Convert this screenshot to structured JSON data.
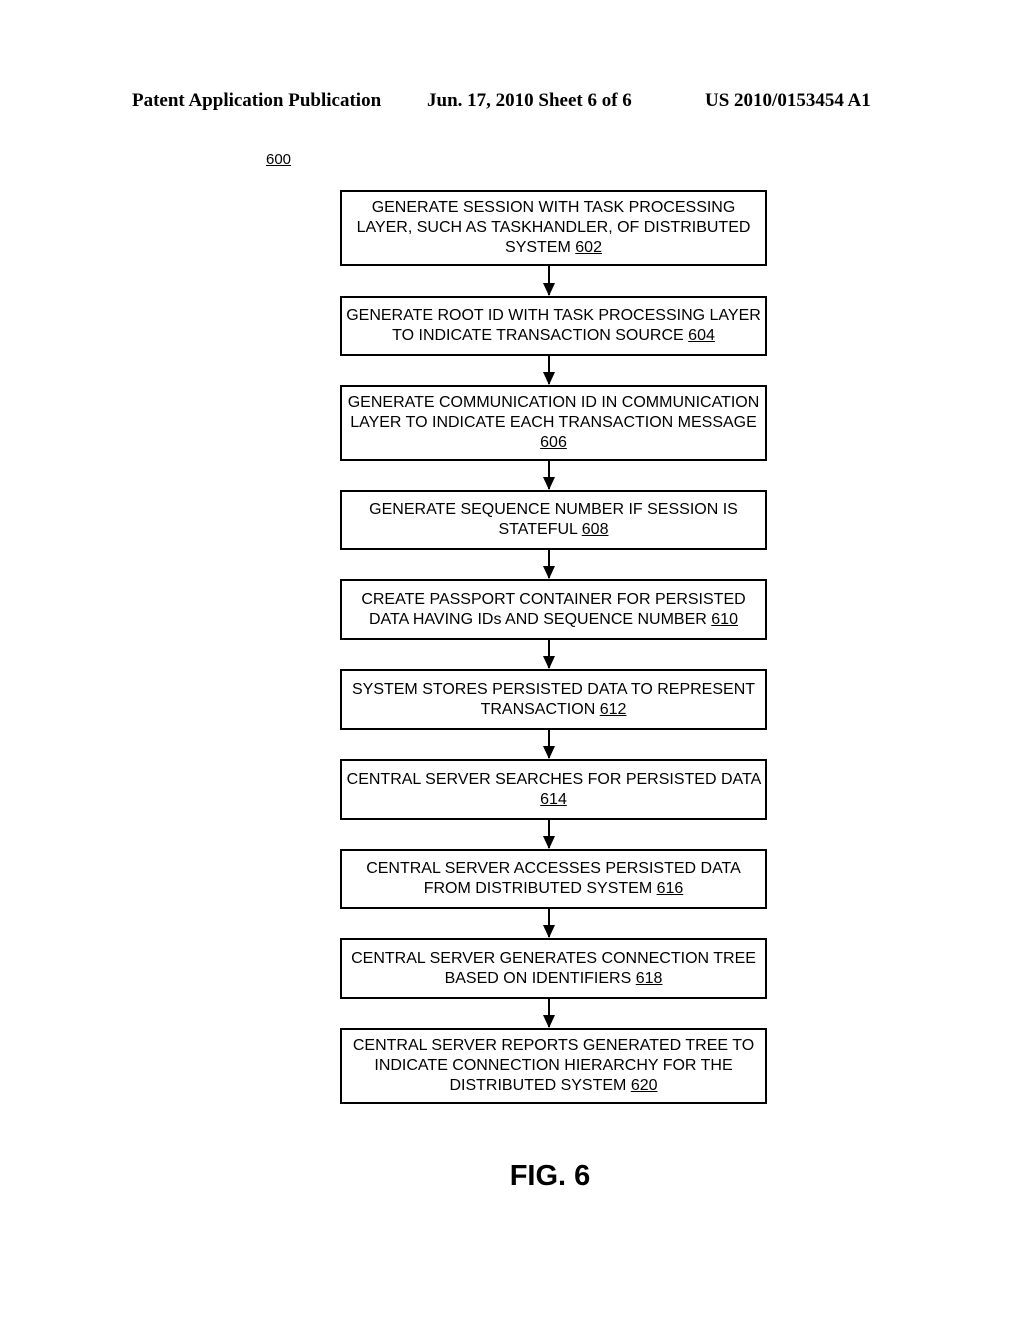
{
  "header": {
    "left": "Patent Application Publication",
    "middle": "Jun. 17, 2010  Sheet 6 of 6",
    "right": "US 2010/0153454 A1"
  },
  "figure_ref": "600",
  "steps": [
    {
      "text": "GENERATE SESSION WITH TASK PROCESSING LAYER, SUCH AS TASKHANDLER, OF DISTRIBUTED SYSTEM",
      "ref": "602"
    },
    {
      "text": "GENERATE ROOT ID WITH TASK PROCESSING LAYER TO INDICATE TRANSACTION SOURCE",
      "ref": "604"
    },
    {
      "text": "GENERATE COMMUNICATION ID IN COMMUNICATION LAYER TO INDICATE EACH TRANSACTION MESSAGE",
      "ref": "606"
    },
    {
      "text": "GENERATE SEQUENCE NUMBER IF SESSION IS STATEFUL",
      "ref": "608"
    },
    {
      "text": "CREATE PASSPORT CONTAINER FOR PERSISTED DATA HAVING IDs AND SEQUENCE NUMBER",
      "ref": "610"
    },
    {
      "text": "SYSTEM STORES PERSISTED DATA TO REPRESENT TRANSACTION",
      "ref": "612"
    },
    {
      "text": "CENTRAL SERVER SEARCHES FOR PERSISTED DATA",
      "ref": "614"
    },
    {
      "text": "CENTRAL SERVER ACCESSES PERSISTED DATA FROM DISTRIBUTED SYSTEM",
      "ref": "616"
    },
    {
      "text": "CENTRAL SERVER GENERATES CONNECTION TREE BASED ON IDENTIFIERS",
      "ref": "618"
    },
    {
      "text": "CENTRAL SERVER REPORTS GENERATED TREE TO INDICATE CONNECTION HIERARCHY FOR THE DISTRIBUTED SYSTEM",
      "ref": "620"
    }
  ],
  "figure_label": "FIG. 6"
}
